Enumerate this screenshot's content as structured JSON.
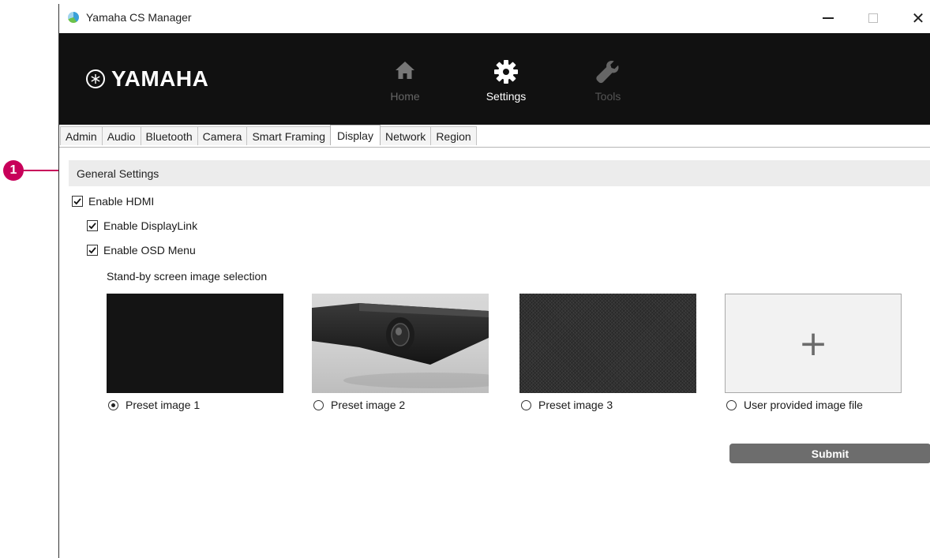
{
  "callout": {
    "number": "1",
    "color": "#c8005a"
  },
  "window": {
    "title": "Yamaha CS Manager",
    "close_glyph": "✕"
  },
  "banner": {
    "brand": "YAMAHA",
    "nav": [
      {
        "label": "Home",
        "icon": "home-icon"
      },
      {
        "label": "Settings",
        "icon": "gear-icon",
        "active": true
      },
      {
        "label": "Tools",
        "icon": "wrench-icon"
      }
    ]
  },
  "tabs": [
    {
      "label": "Admin"
    },
    {
      "label": "Audio"
    },
    {
      "label": "Bluetooth"
    },
    {
      "label": "Camera"
    },
    {
      "label": "Smart Framing"
    },
    {
      "label": "Display",
      "active": true
    },
    {
      "label": "Network"
    },
    {
      "label": "Region"
    }
  ],
  "section": {
    "title": "General Settings",
    "enable_hdmi": {
      "label": "Enable HDMI",
      "checked": true
    },
    "enable_displaylink": {
      "label": "Enable DisplayLink",
      "checked": true
    },
    "enable_osd": {
      "label": "Enable OSD Menu",
      "checked": true
    },
    "standby_label": "Stand-by screen image selection",
    "images": [
      {
        "label": "Preset image 1",
        "selected": true
      },
      {
        "label": "Preset image 2",
        "selected": false
      },
      {
        "label": "Preset image 3",
        "selected": false
      },
      {
        "label": "User provided image file",
        "selected": false,
        "placeholder_glyph": "+"
      }
    ],
    "submit_label": "Submit"
  },
  "colors": {
    "banner_bg": "#111111",
    "section_header_bg": "#ececec",
    "submit_bg": "#6d6d6d"
  }
}
